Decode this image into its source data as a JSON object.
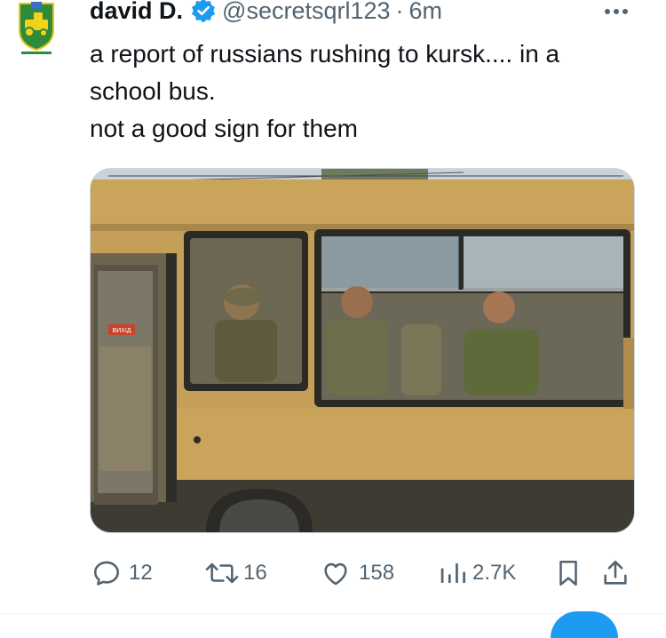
{
  "tweet": {
    "author_name": "david D.",
    "handle": "@secretsqrl123",
    "separator": "·",
    "time": "6m",
    "text_lines": [
      "a report of russians rushing to kursk.... in a",
      "school bus.",
      "not a good sign for them"
    ],
    "bus_sign": "ВИХІД"
  },
  "actions": {
    "replies": "12",
    "reposts": "16",
    "likes": "158",
    "views": "2.7K"
  },
  "colors": {
    "text": "#0f1419",
    "secondary": "#536471",
    "verified": "#1d9bf0",
    "bus_yellow": "#c9a45a"
  }
}
